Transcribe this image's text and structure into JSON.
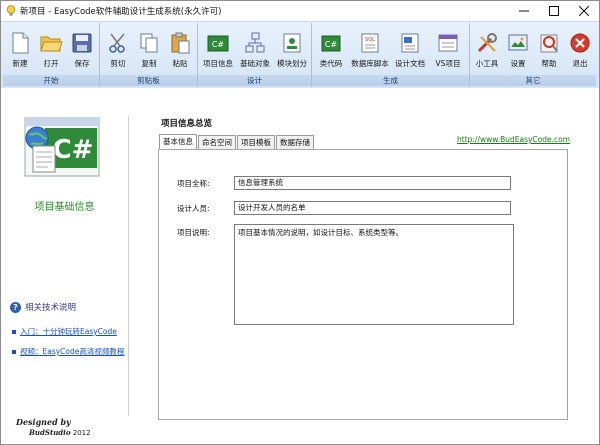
{
  "window": {
    "title": "新项目 - EasyCode软件辅助设计生成系统(永久许可)"
  },
  "ribbon": {
    "groups": [
      {
        "title": "开始",
        "buttons": [
          {
            "label": "新建",
            "icon": "new-file-icon"
          },
          {
            "label": "打开",
            "icon": "open-folder-icon"
          },
          {
            "label": "保存",
            "icon": "save-icon"
          }
        ]
      },
      {
        "title": "剪贴板",
        "buttons": [
          {
            "label": "剪切",
            "icon": "scissors-icon"
          },
          {
            "label": "复制",
            "icon": "copy-icon"
          },
          {
            "label": "粘贴",
            "icon": "paste-icon"
          }
        ]
      },
      {
        "title": "设计",
        "buttons": [
          {
            "label": "项目信息",
            "icon": "project-info-icon"
          },
          {
            "label": "基础对象",
            "icon": "base-object-icon"
          },
          {
            "label": "模块划分",
            "icon": "module-icon"
          }
        ]
      },
      {
        "title": "生成",
        "buttons": [
          {
            "label": "类代码",
            "icon": "class-code-icon"
          },
          {
            "label": "数据库脚本",
            "icon": "sql-script-icon"
          },
          {
            "label": "设计文档",
            "icon": "design-doc-icon"
          },
          {
            "label": "VS项目",
            "icon": "vs-project-icon"
          }
        ]
      },
      {
        "title": "其它",
        "buttons": [
          {
            "label": "小工具",
            "icon": "tools-icon"
          },
          {
            "label": "设置",
            "icon": "settings-icon"
          },
          {
            "label": "帮助",
            "icon": "help-icon"
          },
          {
            "label": "退出",
            "icon": "exit-icon"
          }
        ]
      }
    ]
  },
  "left": {
    "module_title": "项目基础信息",
    "help_heading": "相关技术说明",
    "links": [
      "入门：十分钟玩转EasyCode",
      "视频：EasyCode高清视频教程"
    ],
    "designed_by": "Designed by",
    "studio": "BudStudio",
    "year": "2012"
  },
  "main": {
    "section_title": "项目信息总览",
    "tabs": [
      "基本信息",
      "命名空间",
      "项目模板",
      "数据存储"
    ],
    "active_tab": "基本信息",
    "site_link": "http://www.BudEasyCode.com",
    "fields": {
      "name_label": "项目全称:",
      "name_value": "信息管理系统",
      "designer_label": "设计人员:",
      "designer_value": "设计开发人员的名单",
      "desc_label": "项目说明:",
      "desc_value": "项目基本情况的说明，如设计目标、系统类型等。"
    }
  },
  "colors": {
    "accent": "#2a8a2a",
    "link": "#1a4fc2",
    "ribbon": "#d4e4f6"
  }
}
